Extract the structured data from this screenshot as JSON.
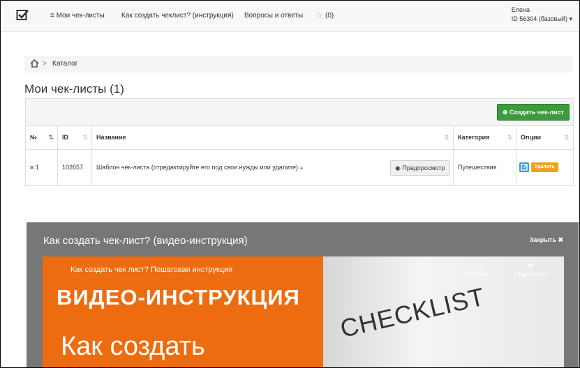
{
  "nav": {
    "menu_label": "≡ Мои чек-листы",
    "howto_label": "Как создать чеклист? (инструкция)",
    "faq_label": "Вопросы и ответы",
    "favorites_count": "(0)",
    "user_name": "Елена",
    "user_id": "ID 56304 (базовый)"
  },
  "breadcrumb": {
    "current": "Каталог"
  },
  "page": {
    "title": "Мои чек-листы (1)"
  },
  "panel": {
    "create_label": "Создать чек-лист",
    "columns": [
      "№",
      "ID",
      "Название",
      "Категория",
      "Опции"
    ],
    "rows": [
      {
        "num": "1",
        "id": "102657",
        "name": "Шаблон чек-листа (отредактируйте его под свои нужды или удалите)",
        "preview_label": "Предпросмотр",
        "category": "Путешествия",
        "delete_label": "Удалить"
      }
    ]
  },
  "modal": {
    "title": "Как создать чек-лист? (видео-инструкция)",
    "close_label": "Закрыть",
    "video": {
      "top_caption": "Как создать чек лист? Пошаговая инструкция",
      "headline": "ВИДЕО-ИНСТРУКЦИЯ",
      "subline": "Как создать",
      "image_word": "CHECKLIST",
      "watch_later": "Смотреть ...",
      "share": "Поделиться"
    }
  },
  "colors": {
    "create": "#3c9b3c",
    "edit": "#3a9bd8",
    "delete": "#f0a020",
    "video_bg": "#ee6c10"
  }
}
